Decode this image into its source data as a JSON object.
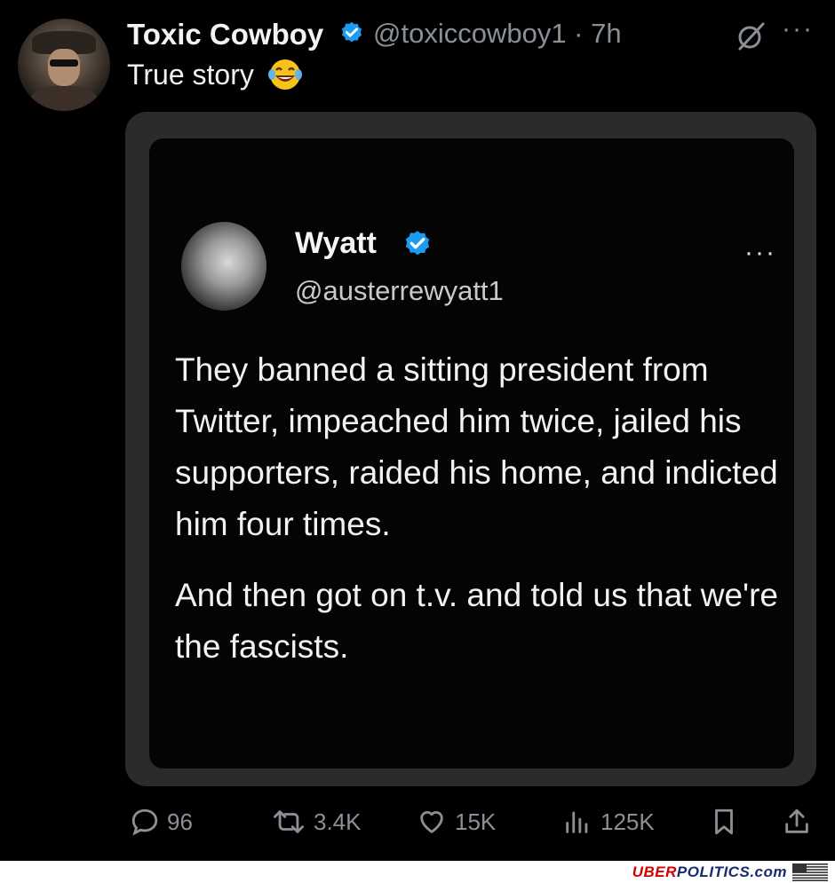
{
  "tweet": {
    "author_name": "Toxic Cowboy",
    "handle_time": "@toxiccowboy1 · 7h",
    "more": "···",
    "text": "True story",
    "emoji": "face-with-tears-of-joy"
  },
  "quoted": {
    "name": "Wyatt",
    "handle": "@austerrewyatt1",
    "more": "···",
    "paragraph1": "They banned a sitting president from Twitter, impeached him twice, jailed his supporters, raided his home, and indicted him four times.",
    "paragraph2": "And then got on t.v. and told us that we're the fascists."
  },
  "actions": {
    "replies": "96",
    "reposts": "3.4K",
    "likes": "15K",
    "views": "125K"
  },
  "footer": {
    "logo_red": "UBER",
    "logo_blue": "POLITICS",
    "logo_suffix": ".com"
  },
  "colors": {
    "verified": "#1d9bf0",
    "muted": "#8b9096"
  }
}
